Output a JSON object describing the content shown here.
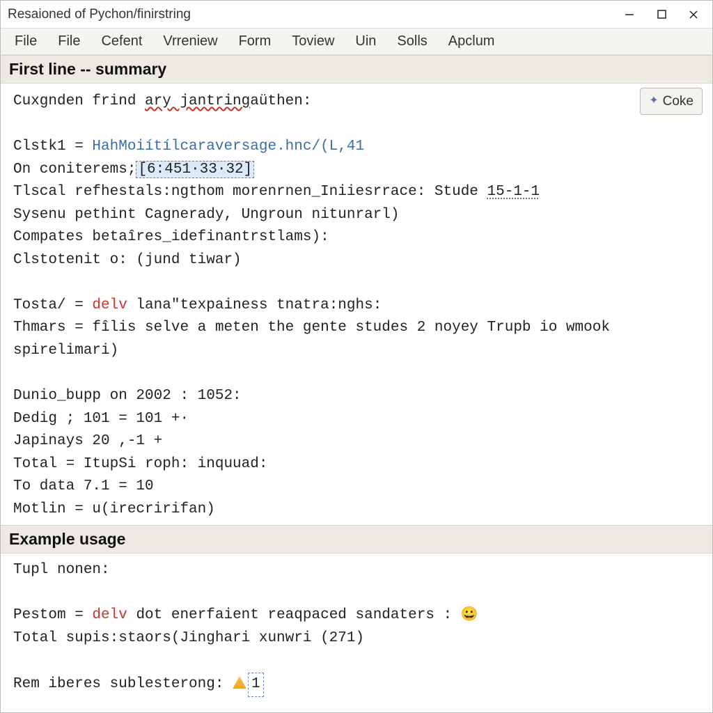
{
  "window_title": "Resaioned of Pychon/finirstring",
  "menubar": [
    "File",
    "File",
    "Cefent",
    "Vrreniew",
    "Form",
    "Toview",
    "Uin",
    "Solls",
    "Apclum"
  ],
  "sections": {
    "first": {
      "header": "First line -- summary",
      "coke_button": "Coke",
      "lines": {
        "l0": "Cuxgnden frind ary jantringaüthen:",
        "l0_wavy": "ary jantring",
        "l1a": "Clstk1 = ",
        "l1b": "HahMoiítílcaraversage.hnc/(L,41",
        "l2a": "On coniterems;",
        "l2b": "[6:451·33·32]",
        "l3a": "Tlscal refhestals:ngthom morenrnen_Iniiesrrace: Stude ",
        "l3b": "15-1-1",
        "l4": "Sysenu pethint Cagnerady, Ungroun nitunrarl)",
        "l5": "Compates betaîres_idefinantrstlams):",
        "l6": "Clstotenit o: (jund tiwar)",
        "l7a": "Tosta/ = ",
        "l7b": "delv",
        "l7c": " lana\"texpainess tnatra:nghs:",
        "l8": "Thmars = fîlis selve a meten the gente studes 2 noyey Trupb io wmook",
        "l9": "spirelimari)",
        "l10": "Dunio_bupp on 2002 : 1052:",
        "l11": "Dedig ; 101 = 101 +·",
        "l12": "Japinays 20 ,-1 +",
        "l13": "Total = ItupSi roph: inquuad:",
        "l14": "To data 7.1 = 10",
        "l15": "Motlin = u(irecririfan)"
      }
    },
    "example": {
      "header": "Example usage",
      "lines": {
        "e0": "Tupl nonen:",
        "e1a": "Pestom = ",
        "e1b": "delv",
        "e1c": " dot enerfaient reaqpaced sandaters : ",
        "e2": "Total supis:staors(Jinghari xunwri (271)",
        "e3a": "Rem iberes sublesterong: ",
        "e3b": "1"
      }
    }
  }
}
